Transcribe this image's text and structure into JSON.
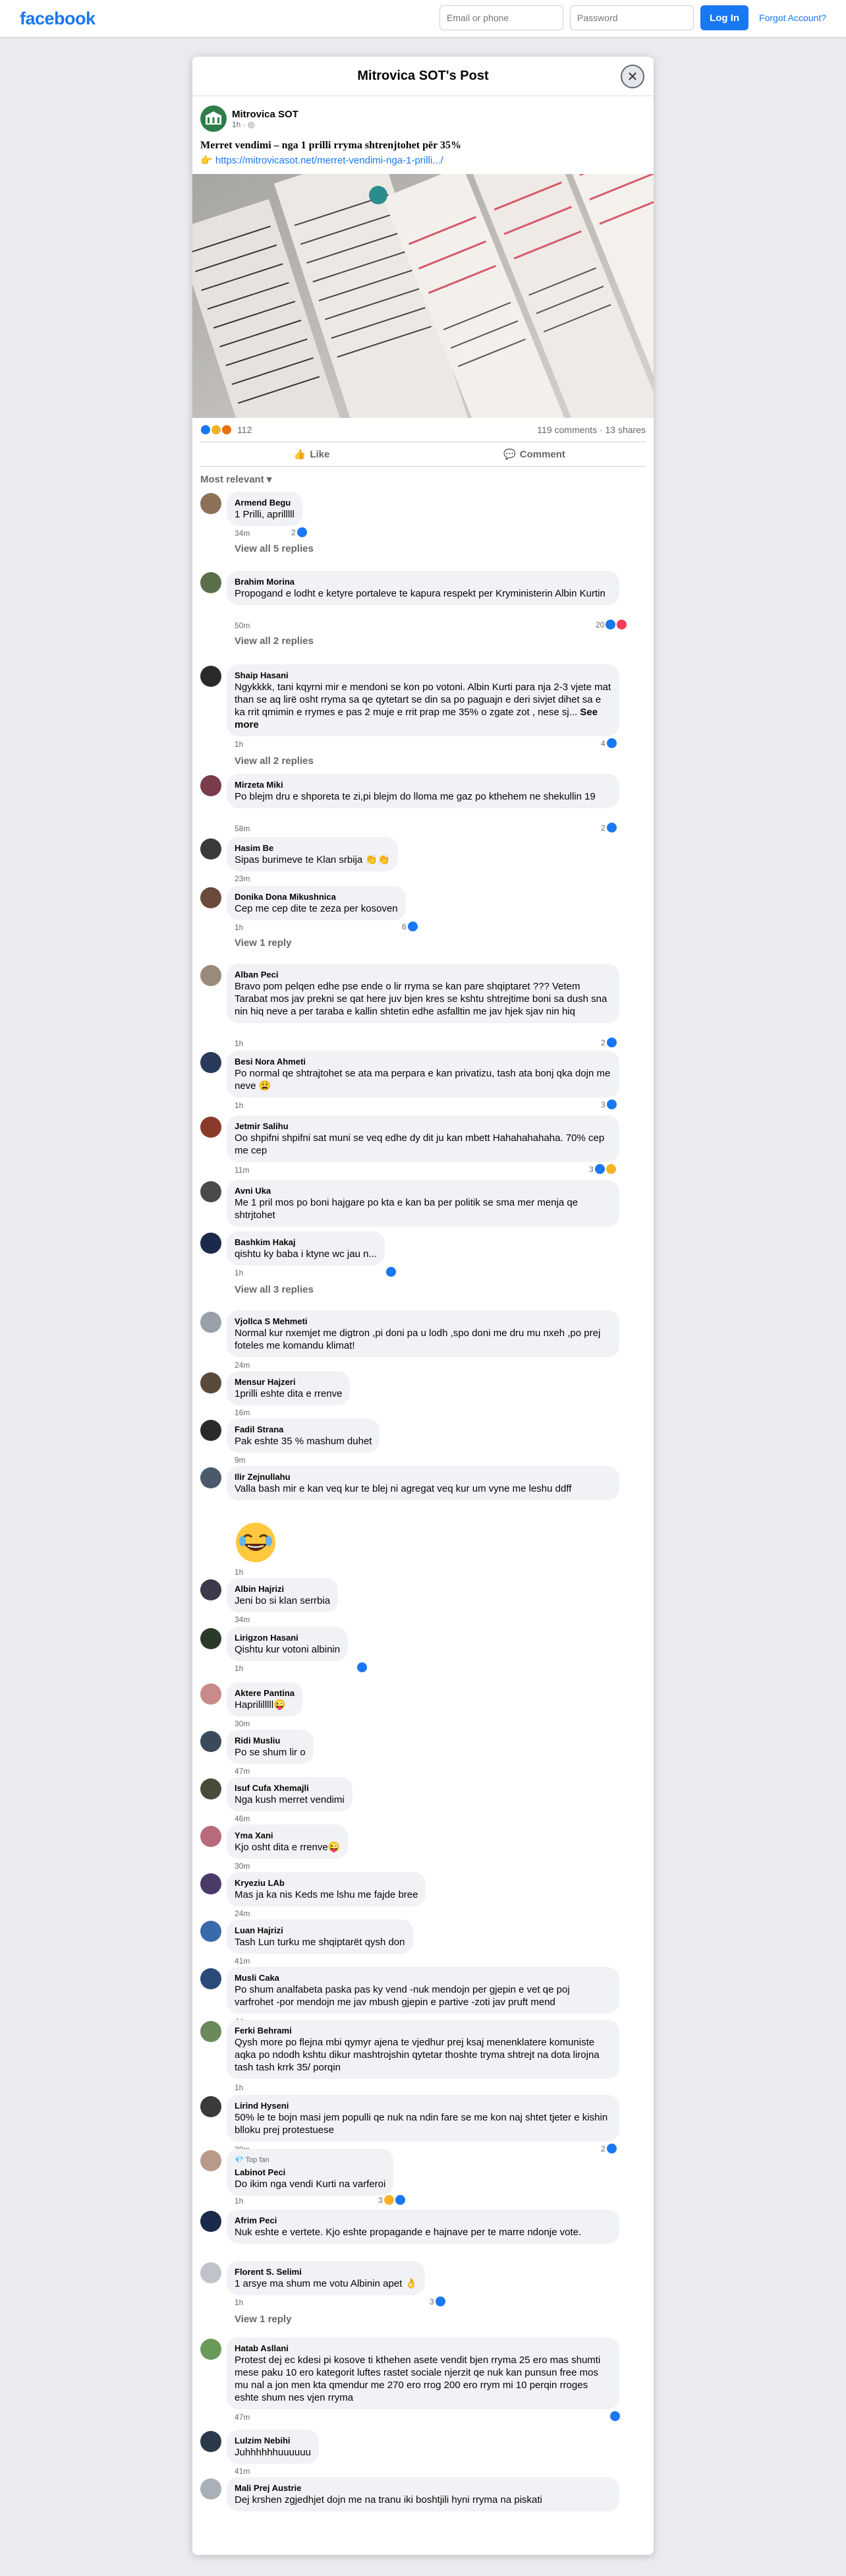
{
  "topbar": {
    "logo": "facebook",
    "email_placeholder": "Email or phone",
    "password_placeholder": "Password",
    "login_label": "Log In",
    "forgot_label": "Forgot Account?"
  },
  "dialog": {
    "title": "Mitrovica SOT's Post"
  },
  "post": {
    "author": "Mitrovica SOT",
    "time": "1h · ",
    "text": "Merret vendimi – nga 1 prilli rryma shtrenjtohet për 35%",
    "link": "https://mitrovicasot.net/merret-vendimi-nga-1-prilli.../",
    "reaction_count": "112",
    "comments_count": "119 comments",
    "shares_count": "13 shares",
    "like_label": "Like",
    "comment_label": "Comment",
    "sort_label": "Most relevant"
  },
  "comments": [
    {
      "name": "Armend Begu",
      "text": "1 Prilli, aprilllll",
      "time": "34m",
      "reacts": "2"
    },
    {
      "name": "Brahim Morina",
      "text": "Propogand e lodht e ketyre portaleve te kapura respekt per Kryministerin Albin Kurtin",
      "time": "50m",
      "reacts": "20"
    },
    {
      "name": "Shaip Hasani",
      "text": "Ngykkkk, tani kqyrni mir e mendoni se kon po votoni. Albin Kurti para nja 2-3 vjete mat than se aq lirë osht rryma sa qe qytetart se din sa po paguajn e deri sivjet dihet sa e ka rrit qmimin e rrymes e pas 2 muje e rrit prap me 35% o zgate zot , nese sj...",
      "see_more": "See more",
      "time": "1h",
      "reacts": "4"
    },
    {
      "name": "Mirzeta Miki",
      "text": "Po blejm dru e shporeta te zi,pi blejm do lloma me gaz po kthehem ne shekullin 19",
      "time": "58m",
      "reacts": "2"
    },
    {
      "name": "Hasim Be",
      "text": "Sipas burimeve te Klan srbija 👏👏",
      "time": "23m"
    },
    {
      "name": "Donika Dona Mikushnica",
      "text": "Cep me cep dite te zeza per kosoven",
      "time": "1h",
      "reacts": "6"
    },
    {
      "name": "Alban Peci",
      "text": "Bravo pom pelqen edhe pse ende o lir rryma se kan pare shqiptaret ??? Vetem Tarabat mos jav prekni se qat here juv bjen kres se kshtu shtrejtime boni sa dush sna nin hiq neve a per taraba e kallin shtetin edhe asfalltin me jav hjek sjav nin hiq",
      "time": "1h",
      "reacts": "2"
    },
    {
      "name": "Besi Nora Ahmeti",
      "text": "Po normal qe shtrajtohet se ata ma perpara e kan privatizu, tash ata bonj qka dojn me neve 😩",
      "time": "1h",
      "reacts": "3"
    },
    {
      "name": "Jetmir Salihu",
      "text": "Oo shpifni shpifni sat muni se veq edhe dy dit ju kan mbett Hahahahahaha. 70% cep me cep",
      "time": "11m",
      "reacts": "3"
    },
    {
      "name": "Avni Uka",
      "text": "Me 1 pril mos po boni hajgare po kta e kan ba per politik se sma mer menja qe shtrjtohet",
      "time": "1h"
    },
    {
      "name": "Bashkim Hakaj",
      "text": "qishtu ky baba i ktyne wc jau n...",
      "time": "1h"
    },
    {
      "name": "Vjollca S Mehmeti",
      "text": "Normal kur nxemjet me digtron ,pi doni pa u lodh ,spo doni me dru mu nxeh ,po prej foteles me komandu klimat!",
      "time": "24m"
    },
    {
      "name": "Mensur Hajzeri",
      "text": "1prilli eshte dita e rrenve",
      "time": "16m"
    },
    {
      "name": "Fadil Strana",
      "text": "Pak eshte 35 % mashum duhet",
      "time": "9m"
    },
    {
      "name": "Ilir Zejnullahu",
      "text": "Valla bash mir e kan veq kur te blej ni agregat veq kur um vyne me leshu ddff",
      "time": "1h"
    },
    {
      "name": "Albin Hajrizi",
      "text": "Jeni bo si klan serrbia",
      "time": "34m"
    },
    {
      "name": "Lirigzon Hasani",
      "text": "Qishtu kur votoni albinin",
      "time": "1h"
    },
    {
      "name": "Aktere Pantina",
      "text": "Haprililllll😜",
      "time": "30m"
    },
    {
      "name": "Ridi Musliu",
      "text": "Po se shum lir o",
      "time": "47m"
    },
    {
      "name": "Isuf Cufa Xhemajli",
      "text": "Nga kush merret vendimi",
      "time": "46m"
    },
    {
      "name": "Yma Xani",
      "text": "Kjo osht dita e rrenve😜",
      "time": "30m"
    },
    {
      "name": "Kryeziu LAb",
      "text": "Mas ja ka nis Keds me lshu me fajde bree",
      "time": "24m"
    },
    {
      "name": "Luan Hajrizi",
      "text": "Tash Lun turku me shqiptarët qysh don",
      "time": "41m"
    },
    {
      "name": "Musli Caka",
      "text": "Po shum analfabeta paska pas ky vend -nuk mendojn per gjepin e vet qe poj varfrohet -por mendojn me jav mbush gjepin e partive -zoti jav pruft mend",
      "time": "44m"
    },
    {
      "name": "Ferki Behrami",
      "text": "Qysh more po flejna mbi qymyr ajena te vjedhur prej ksaj menenklatere komuniste aqka po ndodh kshtu dikur mashtrojshin qytetar thoshte tryma shtrejt na dota lirojna tash tash krrk 35/ porqin",
      "time": "1h"
    },
    {
      "name": "Lirind Hyseni",
      "text": "50% le te bojn masi jem populli qe nuk na ndin fare se me kon naj shtet tjeter e kishin blloku prej protestuese",
      "time": "38m",
      "reacts": "2"
    },
    {
      "name": "Labinot Peci",
      "badge": "Top fan",
      "text": "Do ikim nga vendi Kurti na varferoi",
      "time": "1h",
      "reacts": "3"
    },
    {
      "name": "Afrim Peci",
      "text": "Nuk eshte e vertete. Kjo eshte propagande e hajnave per te marre ndonje vote.",
      "time": "1h"
    },
    {
      "name": "Florent S. Selimi",
      "text": "1 arsye ma shum me votu Albinin apet 👌",
      "time": "1h",
      "reacts": "3"
    },
    {
      "name": "Hatab Asllani",
      "text": "Protest dej ec kdesi pi kosove ti kthehen asete vendit bjen rryma 25 ero mas shumti mese paku 10 ero kategorit luftes rastet sociale njerzit qe nuk kan punsun free mos mu nal a jon men kta qmendur me 270 ero rrog 200 ero rrym mi 10 perqin rroges eshte shum nes vjen rryma",
      "time": "47m"
    },
    {
      "name": "Lulzim Nebihi",
      "text": "Juhhhhhhuuuuuu",
      "time": "41m"
    },
    {
      "name": "Mali Prej Austrie",
      "text": "Dej krshen zgjedhjet dojn me na tranu iki boshtjili hyni rryma na piskati"
    }
  ],
  "replies": {
    "armend": "View all 5 replies",
    "brahim": "View all 2 replies",
    "shaip": "View all 2 replies",
    "donika": "View 1 reply",
    "bashkim": "View all 3 replies",
    "florent": "View 1 reply"
  },
  "colors": {
    "brand": "#1877f2",
    "background": "#e9ebee",
    "bubble": "#f0f2f5",
    "muted": "#65676b"
  }
}
